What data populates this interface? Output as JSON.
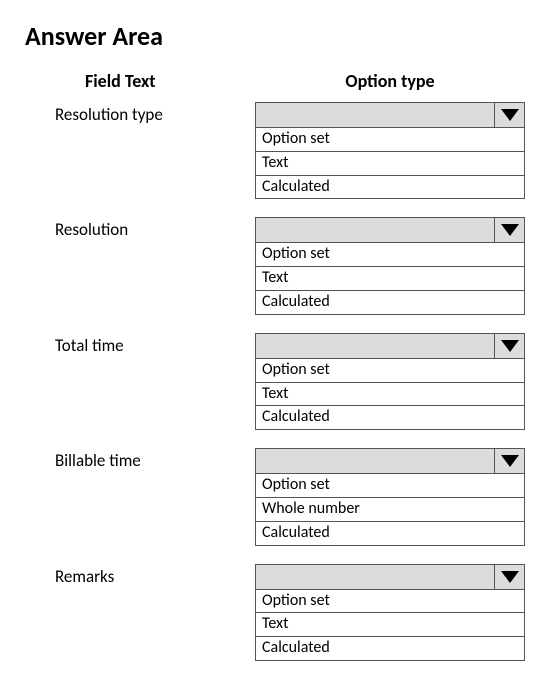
{
  "title": "Answer Area",
  "headers": {
    "field": "Field Text",
    "option": "Option type"
  },
  "rows": [
    {
      "label": "Resolution type",
      "options": [
        "Option set",
        "Text",
        "Calculated"
      ]
    },
    {
      "label": "Resolution",
      "options": [
        "Option set",
        "Text",
        "Calculated"
      ]
    },
    {
      "label": "Total time",
      "options": [
        "Option set",
        "Text",
        "Calculated"
      ]
    },
    {
      "label": "Billable time",
      "options": [
        "Option set",
        "Whole number",
        "Calculated"
      ]
    },
    {
      "label": "Remarks",
      "options": [
        "Option set",
        "Text",
        "Calculated"
      ]
    }
  ]
}
